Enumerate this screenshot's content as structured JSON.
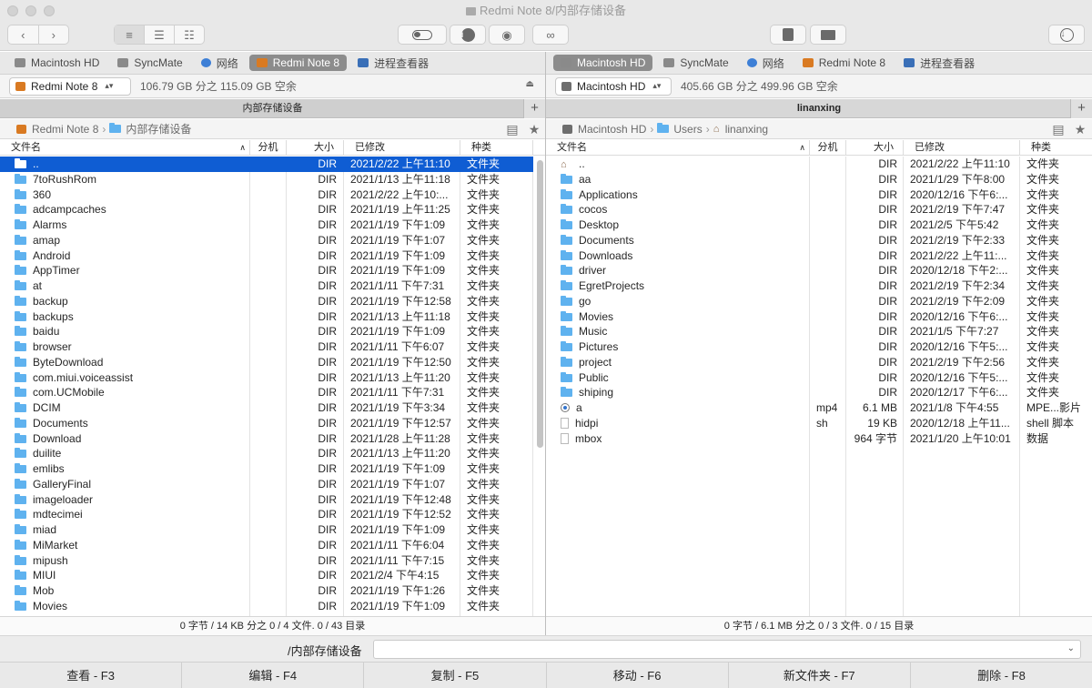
{
  "window": {
    "title": "Redmi Note 8/内部存储设备"
  },
  "toolbar": {
    "back_icon": "chevron-left-icon",
    "forward_icon": "chevron-right-icon",
    "view_modes": [
      "list-view-icon",
      "detail-view-icon",
      "grid-view-icon"
    ],
    "tools": [
      "toggle-icon",
      "info-icon",
      "eye-icon",
      "binoculars-icon"
    ],
    "right_tools": [
      "archive-icon",
      "network-drive-icon",
      "download-icon"
    ]
  },
  "left": {
    "tabs": [
      {
        "label": "Macintosh HD",
        "icon": "disk-icon",
        "active": false
      },
      {
        "label": "SyncMate",
        "icon": "disk-icon",
        "active": false
      },
      {
        "label": "网络",
        "icon": "globe-icon",
        "active": false
      },
      {
        "label": "Redmi Note 8",
        "icon": "android-icon",
        "active": true
      },
      {
        "label": "进程查看器",
        "icon": "monitor-icon",
        "active": false
      }
    ],
    "drive": {
      "name": "Redmi Note 8",
      "free": "106.79 GB 分之 115.09 GB 空余"
    },
    "panel_title": "内部存储设备",
    "path": {
      "device": "Redmi Note 8",
      "folder": "内部存储设备"
    },
    "columns": {
      "name": "文件名",
      "ext": "分机",
      "size": "大小",
      "modified": "已修改",
      "kind": "种类"
    },
    "rows": [
      {
        "name": "..",
        "ext": "",
        "size": "DIR",
        "modified": "2021/2/22 上午11:10",
        "kind": "文件夹",
        "icon": "folder",
        "selected": true
      },
      {
        "name": "7toRushRom",
        "ext": "",
        "size": "DIR",
        "modified": "2021/1/13 上午11:18",
        "kind": "文件夹",
        "icon": "folder"
      },
      {
        "name": "360",
        "ext": "",
        "size": "DIR",
        "modified": "2021/2/22 上午10:...",
        "kind": "文件夹",
        "icon": "folder"
      },
      {
        "name": "adcampcaches",
        "ext": "",
        "size": "DIR",
        "modified": "2021/1/19 上午11:25",
        "kind": "文件夹",
        "icon": "folder"
      },
      {
        "name": "Alarms",
        "ext": "",
        "size": "DIR",
        "modified": "2021/1/19 下午1:09",
        "kind": "文件夹",
        "icon": "folder"
      },
      {
        "name": "amap",
        "ext": "",
        "size": "DIR",
        "modified": "2021/1/19 下午1:07",
        "kind": "文件夹",
        "icon": "folder"
      },
      {
        "name": "Android",
        "ext": "",
        "size": "DIR",
        "modified": "2021/1/19 下午1:09",
        "kind": "文件夹",
        "icon": "folder"
      },
      {
        "name": "AppTimer",
        "ext": "",
        "size": "DIR",
        "modified": "2021/1/19 下午1:09",
        "kind": "文件夹",
        "icon": "folder"
      },
      {
        "name": "at",
        "ext": "",
        "size": "DIR",
        "modified": "2021/1/11 下午7:31",
        "kind": "文件夹",
        "icon": "folder"
      },
      {
        "name": "backup",
        "ext": "",
        "size": "DIR",
        "modified": "2021/1/19 下午12:58",
        "kind": "文件夹",
        "icon": "folder"
      },
      {
        "name": "backups",
        "ext": "",
        "size": "DIR",
        "modified": "2021/1/13 上午11:18",
        "kind": "文件夹",
        "icon": "folder"
      },
      {
        "name": "baidu",
        "ext": "",
        "size": "DIR",
        "modified": "2021/1/19 下午1:09",
        "kind": "文件夹",
        "icon": "folder"
      },
      {
        "name": "browser",
        "ext": "",
        "size": "DIR",
        "modified": "2021/1/11 下午6:07",
        "kind": "文件夹",
        "icon": "folder"
      },
      {
        "name": "ByteDownload",
        "ext": "",
        "size": "DIR",
        "modified": "2021/1/19 下午12:50",
        "kind": "文件夹",
        "icon": "folder"
      },
      {
        "name": "com.miui.voiceassist",
        "ext": "",
        "size": "DIR",
        "modified": "2021/1/13 上午11:20",
        "kind": "文件夹",
        "icon": "folder"
      },
      {
        "name": "com.UCMobile",
        "ext": "",
        "size": "DIR",
        "modified": "2021/1/11 下午7:31",
        "kind": "文件夹",
        "icon": "folder"
      },
      {
        "name": "DCIM",
        "ext": "",
        "size": "DIR",
        "modified": "2021/1/19 下午3:34",
        "kind": "文件夹",
        "icon": "folder"
      },
      {
        "name": "Documents",
        "ext": "",
        "size": "DIR",
        "modified": "2021/1/19 下午12:57",
        "kind": "文件夹",
        "icon": "folder"
      },
      {
        "name": "Download",
        "ext": "",
        "size": "DIR",
        "modified": "2021/1/28 上午11:28",
        "kind": "文件夹",
        "icon": "folder"
      },
      {
        "name": "duilite",
        "ext": "",
        "size": "DIR",
        "modified": "2021/1/13 上午11:20",
        "kind": "文件夹",
        "icon": "folder"
      },
      {
        "name": "emlibs",
        "ext": "",
        "size": "DIR",
        "modified": "2021/1/19 下午1:09",
        "kind": "文件夹",
        "icon": "folder"
      },
      {
        "name": "GalleryFinal",
        "ext": "",
        "size": "DIR",
        "modified": "2021/1/19 下午1:07",
        "kind": "文件夹",
        "icon": "folder"
      },
      {
        "name": "imageloader",
        "ext": "",
        "size": "DIR",
        "modified": "2021/1/19 下午12:48",
        "kind": "文件夹",
        "icon": "folder"
      },
      {
        "name": "mdtecimei",
        "ext": "",
        "size": "DIR",
        "modified": "2021/1/19 下午12:52",
        "kind": "文件夹",
        "icon": "folder"
      },
      {
        "name": "miad",
        "ext": "",
        "size": "DIR",
        "modified": "2021/1/19 下午1:09",
        "kind": "文件夹",
        "icon": "folder"
      },
      {
        "name": "MiMarket",
        "ext": "",
        "size": "DIR",
        "modified": "2021/1/11 下午6:04",
        "kind": "文件夹",
        "icon": "folder"
      },
      {
        "name": "mipush",
        "ext": "",
        "size": "DIR",
        "modified": "2021/1/11 下午7:15",
        "kind": "文件夹",
        "icon": "folder"
      },
      {
        "name": "MIUI",
        "ext": "",
        "size": "DIR",
        "modified": "2021/2/4 下午4:15",
        "kind": "文件夹",
        "icon": "folder"
      },
      {
        "name": "Mob",
        "ext": "",
        "size": "DIR",
        "modified": "2021/1/19 下午1:26",
        "kind": "文件夹",
        "icon": "folder"
      },
      {
        "name": "Movies",
        "ext": "",
        "size": "DIR",
        "modified": "2021/1/19 下午1:09",
        "kind": "文件夹",
        "icon": "folder"
      }
    ],
    "status": "0 字节 / 14 KB 分之 0 / 4 文件. 0 / 43 目录"
  },
  "right": {
    "tabs": [
      {
        "label": "Macintosh HD",
        "icon": "disk-icon",
        "active": true
      },
      {
        "label": "SyncMate",
        "icon": "disk-icon",
        "active": false
      },
      {
        "label": "网络",
        "icon": "globe-icon",
        "active": false
      },
      {
        "label": "Redmi Note 8",
        "icon": "android-icon",
        "active": false
      },
      {
        "label": "进程查看器",
        "icon": "monitor-icon",
        "active": false
      }
    ],
    "drive": {
      "name": "Macintosh HD",
      "free": "405.66 GB 分之 499.96 GB 空余"
    },
    "panel_title": "linanxing",
    "path": {
      "device": "Macintosh HD",
      "folder1": "Users",
      "folder2": "linanxing"
    },
    "columns": {
      "name": "文件名",
      "ext": "分机",
      "size": "大小",
      "modified": "已修改",
      "kind": "种类"
    },
    "rows": [
      {
        "name": "..",
        "ext": "",
        "size": "DIR",
        "modified": "2021/2/22 上午11:10",
        "kind": "文件夹",
        "icon": "home"
      },
      {
        "name": "aa",
        "ext": "",
        "size": "DIR",
        "modified": "2021/1/29 下午8:00",
        "kind": "文件夹",
        "icon": "folder"
      },
      {
        "name": "Applications",
        "ext": "",
        "size": "DIR",
        "modified": "2020/12/16 下午6:...",
        "kind": "文件夹",
        "icon": "folder"
      },
      {
        "name": "cocos",
        "ext": "",
        "size": "DIR",
        "modified": "2021/2/19 下午7:47",
        "kind": "文件夹",
        "icon": "folder"
      },
      {
        "name": "Desktop",
        "ext": "",
        "size": "DIR",
        "modified": "2021/2/5 下午5:42",
        "kind": "文件夹",
        "icon": "folder"
      },
      {
        "name": "Documents",
        "ext": "",
        "size": "DIR",
        "modified": "2021/2/19 下午2:33",
        "kind": "文件夹",
        "icon": "folder"
      },
      {
        "name": "Downloads",
        "ext": "",
        "size": "DIR",
        "modified": "2021/2/22 上午11:...",
        "kind": "文件夹",
        "icon": "folder"
      },
      {
        "name": "driver",
        "ext": "",
        "size": "DIR",
        "modified": "2020/12/18 下午2:...",
        "kind": "文件夹",
        "icon": "folder"
      },
      {
        "name": "EgretProjects",
        "ext": "",
        "size": "DIR",
        "modified": "2021/2/19 下午2:34",
        "kind": "文件夹",
        "icon": "folder"
      },
      {
        "name": "go",
        "ext": "",
        "size": "DIR",
        "modified": "2021/2/19 下午2:09",
        "kind": "文件夹",
        "icon": "folder"
      },
      {
        "name": "Movies",
        "ext": "",
        "size": "DIR",
        "modified": "2020/12/16 下午6:...",
        "kind": "文件夹",
        "icon": "folder"
      },
      {
        "name": "Music",
        "ext": "",
        "size": "DIR",
        "modified": "2021/1/5 下午7:27",
        "kind": "文件夹",
        "icon": "folder"
      },
      {
        "name": "Pictures",
        "ext": "",
        "size": "DIR",
        "modified": "2020/12/16 下午5:...",
        "kind": "文件夹",
        "icon": "folder"
      },
      {
        "name": "project",
        "ext": "",
        "size": "DIR",
        "modified": "2021/2/19 下午2:56",
        "kind": "文件夹",
        "icon": "folder"
      },
      {
        "name": "Public",
        "ext": "",
        "size": "DIR",
        "modified": "2020/12/16 下午5:...",
        "kind": "文件夹",
        "icon": "folder"
      },
      {
        "name": "shiping",
        "ext": "",
        "size": "DIR",
        "modified": "2020/12/17 下午6:...",
        "kind": "文件夹",
        "icon": "folder"
      },
      {
        "name": "a",
        "ext": "mp4",
        "size": "6.1 MB",
        "modified": "2021/1/8 下午4:55",
        "kind": "MPE...影片",
        "icon": "mp4"
      },
      {
        "name": "hidpi",
        "ext": "sh",
        "size": "19 KB",
        "modified": "2020/12/18 上午11...",
        "kind": "shell 脚本",
        "icon": "file"
      },
      {
        "name": "mbox",
        "ext": "",
        "size": "964 字节",
        "modified": "2021/1/20 上午10:01",
        "kind": "数据",
        "icon": "file"
      }
    ],
    "status": "0 字节 / 6.1 MB 分之 0 / 3 文件. 0 / 15 目录"
  },
  "command": {
    "label": "/内部存储设备",
    "value": ""
  },
  "fkeys": [
    "查看 - F3",
    "编辑 - F4",
    "复制 - F5",
    "移动 - F6",
    "新文件夹 - F7",
    "删除 - F8"
  ],
  "colors": {
    "selection": "#0f5dd3",
    "folder": "#5fb2ef"
  }
}
